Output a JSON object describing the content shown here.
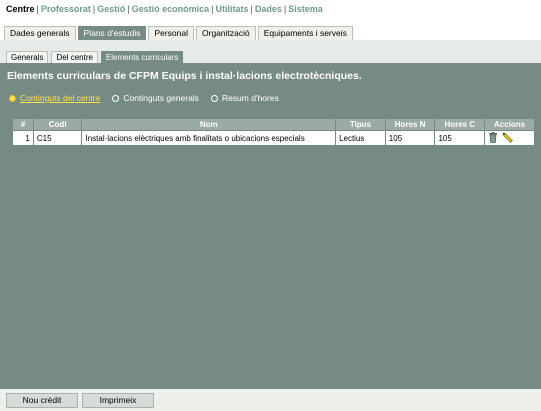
{
  "main_menu": [
    "Centre",
    "Professorat",
    "Gestió",
    "Gestió econòmica",
    "Utilitats",
    "Dades",
    "Sistema"
  ],
  "tabs": [
    "Dades generals",
    "Plans d'estudis",
    "Personal",
    "Organització",
    "Equipaments i serveis"
  ],
  "subtabs": [
    "Generals",
    "Del centre",
    "Elements curriculars"
  ],
  "page_title": "Elements curriculars de CFPM Equips i instal·lacions electrotècniques.",
  "radio_options": [
    "Continguts del centre",
    "Continguts generals",
    "Resum d'hores"
  ],
  "table": {
    "headers": [
      "#",
      "Codi",
      "Nom",
      "Tipus",
      "Hores N",
      "Hores C",
      "Accions"
    ],
    "rows": [
      {
        "n": "1",
        "codi": "C15",
        "nom": "Instal·lacions elèctriques amb finalitats o ubicacions especials",
        "tipus": "Lectius",
        "hores_n": "105",
        "hores_c": "105"
      }
    ]
  },
  "icons": {
    "delete": "trash-icon",
    "edit": "pencil-icon"
  },
  "buttons": {
    "new": "Nou crèdit",
    "print": "Imprimeix"
  },
  "colors": {
    "panel": "#778b85",
    "menu_link": "#6f9990",
    "selected": "#ffe14d"
  }
}
